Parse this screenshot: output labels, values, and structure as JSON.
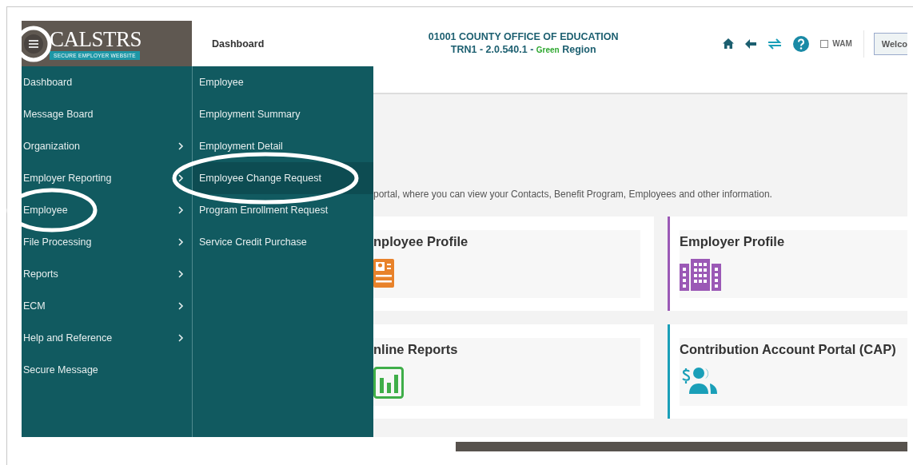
{
  "header": {
    "menu_button": {
      "circled": true
    },
    "logo": {
      "name": "CALSTRS",
      "tagline": "SECURE EMPLOYER WEBSITE"
    },
    "page_title": "Dashboard",
    "org": {
      "name": "01001 COUNTY OFFICE OF EDUCATION",
      "version": "TRN1 - 2.0.540.1 - ",
      "region_color": "Green",
      "region_suffix": " Region"
    },
    "wam": {
      "label": "WAM",
      "checked": false
    },
    "welcome_button": "Welco"
  },
  "menu": {
    "items": [
      {
        "label": "Dashboard",
        "has_children": false,
        "circled": false
      },
      {
        "label": "Message Board",
        "has_children": false,
        "circled": false
      },
      {
        "label": "Organization",
        "has_children": true,
        "circled": false
      },
      {
        "label": "Employer Reporting",
        "has_children": true,
        "circled": false
      },
      {
        "label": "Employee",
        "has_children": true,
        "circled": true
      },
      {
        "label": "File Processing",
        "has_children": true,
        "circled": false
      },
      {
        "label": "Reports",
        "has_children": true,
        "circled": false
      },
      {
        "label": "ECM",
        "has_children": true,
        "circled": false
      },
      {
        "label": "Help and Reference",
        "has_children": true,
        "circled": false
      },
      {
        "label": "Secure Message",
        "has_children": false,
        "circled": false
      }
    ],
    "submenu": [
      {
        "label": "Employee",
        "selected": false,
        "circled": false
      },
      {
        "label": "Employment Summary",
        "selected": false,
        "circled": false
      },
      {
        "label": "Employment Detail",
        "selected": false,
        "circled": false
      },
      {
        "label": "Employee Change Request",
        "selected": true,
        "circled": true
      },
      {
        "label": "Program Enrollment Request",
        "selected": false,
        "circled": false
      },
      {
        "label": "Service Credit Purchase",
        "selected": false,
        "circled": false
      }
    ]
  },
  "intro": "portal, where you can view your Contacts, Benefit Program, Employees and other information.",
  "cards": [
    {
      "title": "nployee Profile",
      "kind": "id-card",
      "color": "#e8822a",
      "accent": false
    },
    {
      "title": "Employer Profile",
      "kind": "building",
      "color": "#9b59b6",
      "accent": true
    },
    {
      "title": "nline Reports",
      "kind": "bar-chart",
      "color": "#3fae49",
      "accent": false
    },
    {
      "title": "Contribution Account Portal (CAP)",
      "kind": "people-dollar",
      "color": "#1a9fb8",
      "accent": true
    }
  ]
}
